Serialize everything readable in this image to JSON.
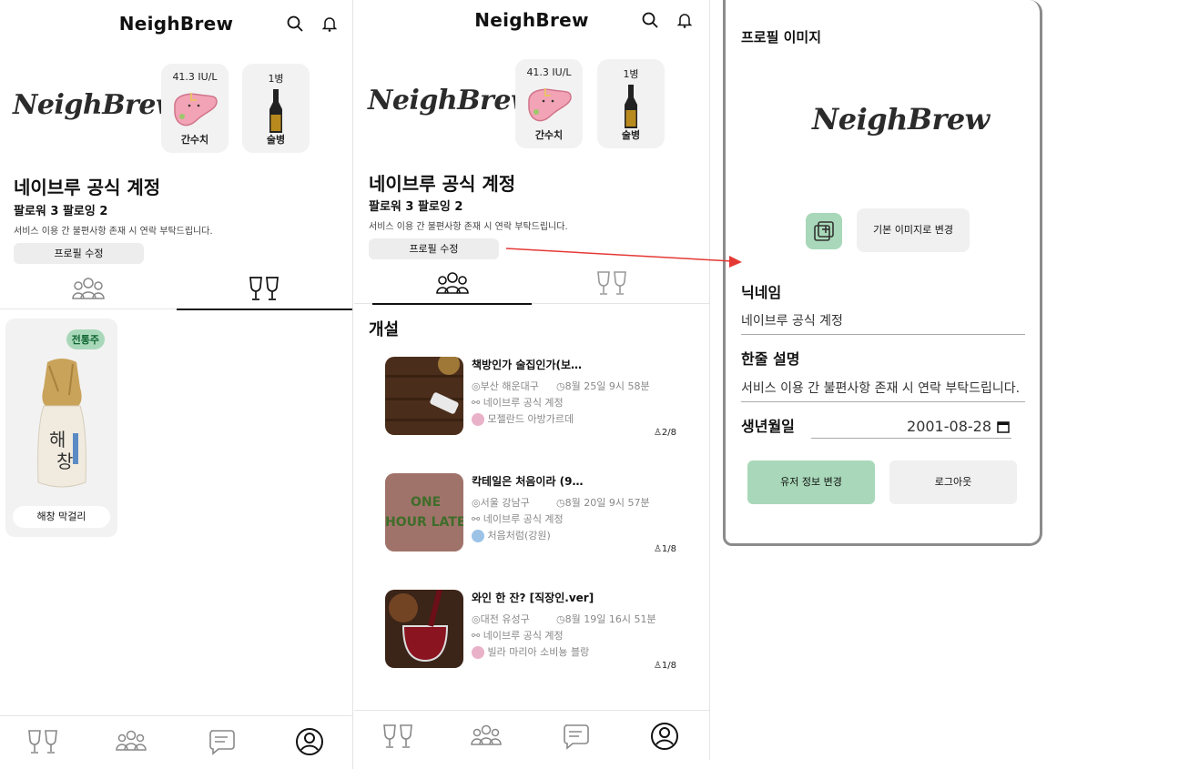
{
  "app_title": "NeighBrew",
  "brand_logo": "NeighBrew",
  "stats": {
    "liver_value": "41.3 IU/L",
    "liver_label": "간수치",
    "bottle_value": "1병",
    "bottle_label": "술병"
  },
  "profile": {
    "name": "네이브루 공식 계정",
    "follow": "팔로워 3 팔로잉 2",
    "bio": "서비스 이용 간 불편사항 존재 시 연락 부탁드립니다.",
    "edit_label": "프로필 수정"
  },
  "drink": {
    "badge": "전통주",
    "name": "해창 막걸리"
  },
  "meet_section_title": "개설",
  "meetings": [
    {
      "title": "책방인가 술집인가(보…",
      "location": "부산 해운대구",
      "datetime": "8월 25일 9시 58분",
      "host": "네이브루 공식 계정",
      "drink": "모젤란드 아방가르데",
      "count": "2/8"
    },
    {
      "title": "칵테일은 처음이라 (9…",
      "location": "서울 강남구",
      "datetime": "8월 20일 9시 57분",
      "host": "네이브루 공식 계정",
      "drink": "처음처럼(강원)",
      "count": "1/8"
    },
    {
      "title": "와인 한 잔? [직장인.ver]",
      "location": "대전 유성구",
      "datetime": "8월 19일 16시 51분",
      "host": "네이브루 공식 계정",
      "drink": "빌라 마리아 소비뇽 블랑",
      "count": "1/8"
    }
  ],
  "thumb_text": "ONE HOUR LATER",
  "panel": {
    "heading": "프로필 이미지",
    "logo": "NeighBrew",
    "default_image_label": "기본 이미지로 변경",
    "nickname_label": "닉네임",
    "nickname_value": "네이브루 공식 계정",
    "bio_label": "한줄 설명",
    "bio_value": "서비스 이용 간 불편사항 존재 시 연락 부탁드립니다.",
    "birth_label": "생년월일",
    "birth_value": "2001-08-28",
    "change_button": "유저 정보 변경",
    "logout_button": "로그아웃"
  },
  "colors": {
    "accent_green": "#a8d8b9",
    "card_gray": "#f2f2f2",
    "arrow_red": "#e53935"
  },
  "icons": [
    "search-icon",
    "bell-icon",
    "liver-icon",
    "bottle-icon",
    "people-icon",
    "wine-glasses-icon",
    "chat-icon",
    "profile-icon",
    "add-image-icon",
    "calendar-icon"
  ]
}
